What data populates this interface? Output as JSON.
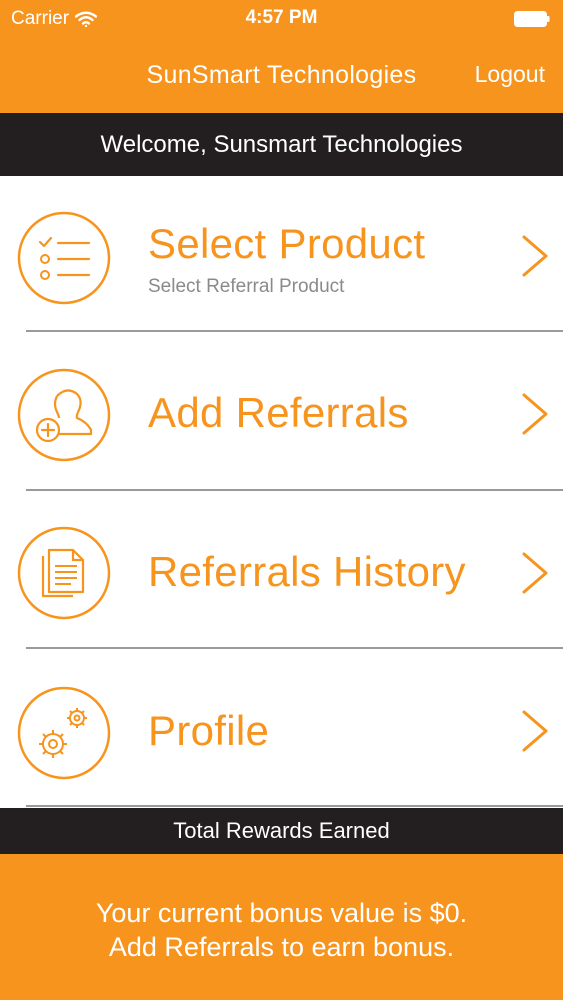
{
  "status_bar": {
    "carrier": "Carrier",
    "time": "4:57 PM",
    "wifi_icon": "wifi-icon",
    "battery_icon": "battery-icon"
  },
  "header": {
    "title": "SunSmart Technologies",
    "logout_label": "Logout"
  },
  "welcome": {
    "text": "Welcome, Sunsmart Technologies"
  },
  "menu": {
    "items": [
      {
        "label": "Select Product",
        "subtitle": "Select Referral Product",
        "icon": "checklist-icon"
      },
      {
        "label": "Add Referrals",
        "subtitle": "",
        "icon": "add-user-icon"
      },
      {
        "label": "Referrals History",
        "subtitle": "",
        "icon": "documents-icon"
      },
      {
        "label": "Profile",
        "subtitle": "",
        "icon": "gears-icon"
      }
    ]
  },
  "rewards": {
    "header": "Total Rewards Earned",
    "line1": "Your current bonus value is $0.",
    "line2": "Add Referrals to earn bonus."
  },
  "colors": {
    "brand_orange": "#F7941D",
    "dark_bar": "#231F20",
    "subtitle_gray": "#8a8a8a"
  }
}
